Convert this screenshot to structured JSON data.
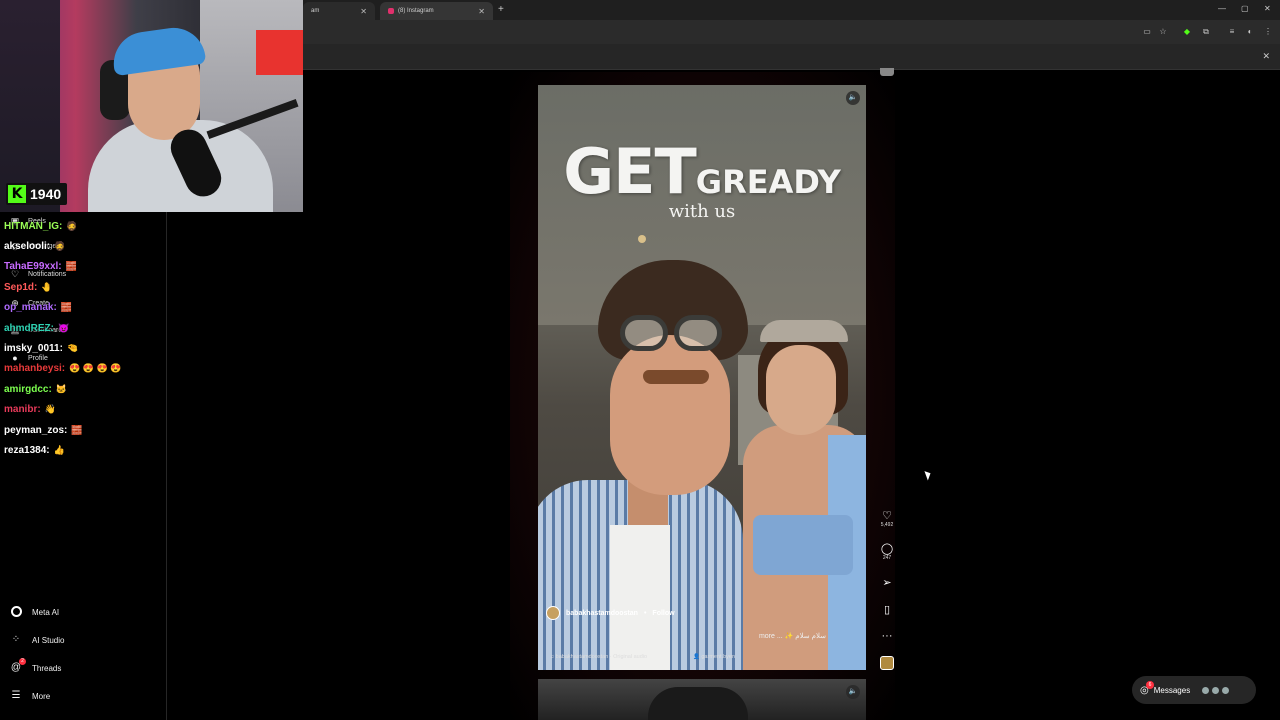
{
  "browser": {
    "tabs": [
      {
        "label": "am"
      },
      {
        "label": "(8) Instagram"
      }
    ],
    "new_tab": "+",
    "window_controls": [
      "—",
      "▢",
      "✕"
    ],
    "bookmark_close": "✕"
  },
  "stream": {
    "viewer_count": "1940",
    "platform_logo": "K",
    "chat": [
      {
        "user": "HITMAN_IG:",
        "color": "#9cff57",
        "emotes": "🧔"
      },
      {
        "user": "akselooli:",
        "color": "#ffffff",
        "emotes": "🧔"
      },
      {
        "user": "TahaE99xxl:",
        "color": "#c86bff",
        "emotes": "🧱"
      },
      {
        "user": "Sep1d:",
        "color": "#ff5a5a",
        "emotes": "🤚"
      },
      {
        "user": "op_manak:",
        "color": "#b06bff",
        "emotes": "🧱"
      },
      {
        "user": "ahmdREZ:",
        "color": "#2fd2b2",
        "emotes": "😈"
      },
      {
        "user": "imsky_0011:",
        "color": "#ffffff",
        "emotes": "🤏"
      },
      {
        "user": "mahanbeysi:",
        "color": "#e83a3a",
        "emotes": "😍 😍 😍 😍"
      },
      {
        "user": "amirgdcc:",
        "color": "#7cff4f",
        "emotes": "🐱"
      },
      {
        "user": "manibr:",
        "color": "#e83a5a",
        "emotes": "👋"
      },
      {
        "user": "peyman_zos:",
        "color": "#ffffff",
        "emotes": "🧱"
      },
      {
        "user": "reza1384:",
        "color": "#ffffff",
        "emotes": "👍"
      }
    ]
  },
  "sidebar": {
    "partial_items": [
      {
        "label": "Reels",
        "icon": "reels-icon"
      },
      {
        "label": "Messages",
        "icon": "messages-icon"
      },
      {
        "label": "Notifications",
        "icon": "heart-icon"
      },
      {
        "label": "Create",
        "icon": "plus-icon"
      },
      {
        "label": "Dashboard",
        "icon": "dashboard-icon"
      },
      {
        "label": "Profile",
        "icon": "profile-icon"
      }
    ],
    "bottom_items": [
      {
        "label": "Meta AI",
        "icon": "meta-ai-icon"
      },
      {
        "label": "AI Studio",
        "icon": "ai-studio-icon"
      },
      {
        "label": "Threads",
        "icon": "threads-icon",
        "badge": "2"
      },
      {
        "label": "More",
        "icon": "menu-icon"
      }
    ]
  },
  "reel": {
    "overlay_title_big": "GET",
    "overlay_title_small": "GREADY",
    "overlay_subtitle": "with us",
    "author": "babakhastamdoostan",
    "separator": "•",
    "follow_label": "Follow",
    "caption": "more ... ✨ سلام سلام",
    "audio": "♫ babakhastamdoostan · Original audio",
    "tagged": "👤 garment.byen",
    "like_count": "5,492",
    "comment_count": "247"
  },
  "messages_pill": {
    "label": "Messages",
    "badge": "6"
  },
  "colors": {
    "kick_green": "#53fc18",
    "instagram_badge": "#ff3040"
  }
}
